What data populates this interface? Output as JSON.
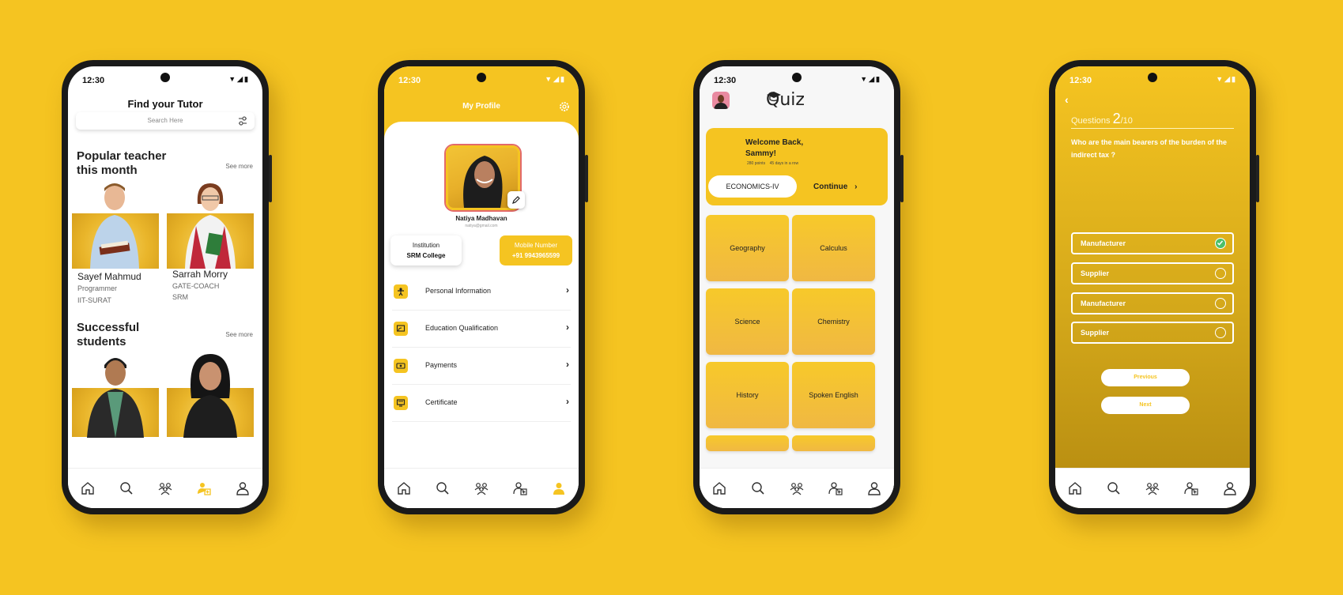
{
  "status": {
    "time": "12:30"
  },
  "nav_icons": [
    "home-icon",
    "search-icon",
    "group-icon",
    "add-person-icon",
    "profile-icon"
  ],
  "colors": {
    "accent": "#F5C421",
    "correct": "#4cc06a"
  },
  "tutor": {
    "title": "Find your Tutor",
    "search_placeholder": "Search Here",
    "popular_heading": "Popular teacher this month",
    "see_more_1": "See more",
    "teachers": [
      {
        "name": "Sayef Mahmud",
        "role": "Programmer",
        "org": "IIT-SURAT"
      },
      {
        "name": "Sarrah Morry",
        "role": "GATE-COACH",
        "org": "SRM"
      }
    ],
    "students_heading": "Successful students",
    "see_more_2": "See more"
  },
  "profile": {
    "title": "My Profile",
    "name": "Natiya Madhavan",
    "email": "natiya@gmail.com",
    "institution_label": "Institution",
    "institution_value": "SRM College",
    "mobile_label": "Mobile Number",
    "mobile_value": "+91 9943965599",
    "menu": [
      {
        "label": "Personal Information",
        "icon": "person-icon"
      },
      {
        "label": "Education Qualification",
        "icon": "certificate-screen-icon"
      },
      {
        "label": "Payments",
        "icon": "payment-icon"
      },
      {
        "label": "Certificate",
        "icon": "certificate-icon"
      }
    ]
  },
  "quiz": {
    "logo": "Quiz",
    "welcome_line1": "Welcome Back,",
    "welcome_line2": "Sammy!",
    "points": "280 points",
    "streak": "45 days in a row",
    "course": "ECONOMICS-IV",
    "continue": "Continue",
    "subjects": [
      "Geography",
      "Calculus",
      "Science",
      "Chemistry",
      "History",
      "Spoken English"
    ]
  },
  "question": {
    "label": "Questions",
    "number": "2",
    "total": "/10",
    "text": "Who are the main bearers of the burden of the indirect tax ?",
    "options": [
      {
        "label": "Manufacturer",
        "selected": true
      },
      {
        "label": "Supplier",
        "selected": false
      },
      {
        "label": "Manufacturer",
        "selected": false
      },
      {
        "label": "Supplier",
        "selected": false
      }
    ],
    "previous": "Previous",
    "next": "Next"
  }
}
